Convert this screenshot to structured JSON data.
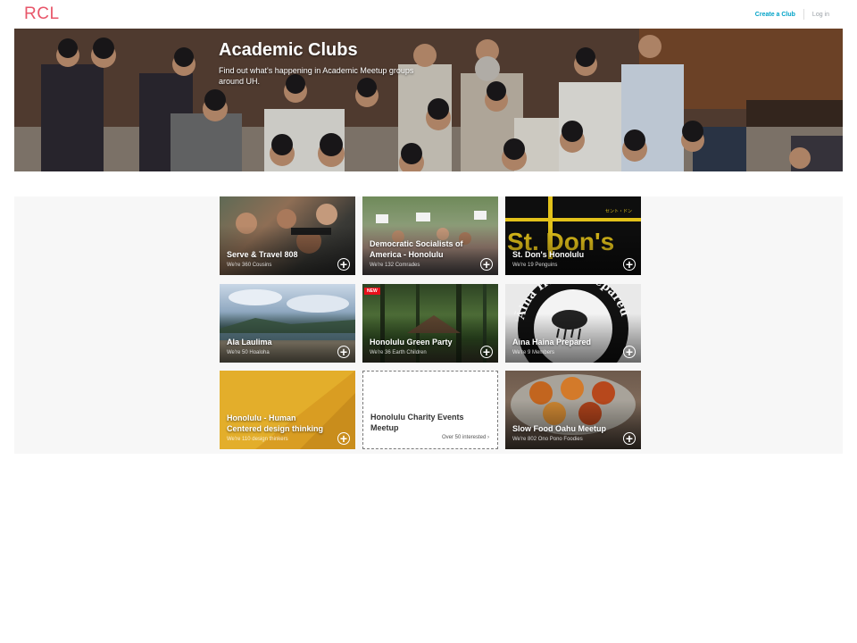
{
  "header": {
    "logo": "RCL",
    "create_label": "Create a Club",
    "login_label": "Log in"
  },
  "hero": {
    "title": "Academic Clubs",
    "subtitle": "Find out what's happening in Academic Meetup groups around UH."
  },
  "clubs": [
    {
      "name": "Serve & Travel 808",
      "members": "We're 360 Cousins"
    },
    {
      "name": "Democratic Socialists of America - Honolulu",
      "members": "We're 132 Comrades"
    },
    {
      "name": "St. Don's Honolulu",
      "members": "We're 19 Penguins"
    },
    {
      "name": "Ala Laulima",
      "members": "We're 50 Hoaloha"
    },
    {
      "name": "Honolulu Green Party",
      "members": "We're 36 Earth Children",
      "badge": "NEW"
    },
    {
      "name": "Aina Haina Prepared",
      "members": "We're 9 Members"
    },
    {
      "name": "Honolulu - Human Centered design thinking",
      "members": "We're 110 design thinkers"
    },
    {
      "name": "Honolulu Charity Events Meetup",
      "interest": "Over 50 interested ›"
    },
    {
      "name": "Slow Food Oahu Meetup",
      "members": "We're 802 Ono Pono Foodies"
    }
  ],
  "images": {
    "don_sign": "St. Don's",
    "don_small": "セント・ドン",
    "aina_seal": "'Āina Haina Prepared"
  },
  "colors": {
    "brand": "#e8566a",
    "link": "#00a2c7",
    "badge": "#e8101b",
    "design_card": "#e3ae2b"
  }
}
